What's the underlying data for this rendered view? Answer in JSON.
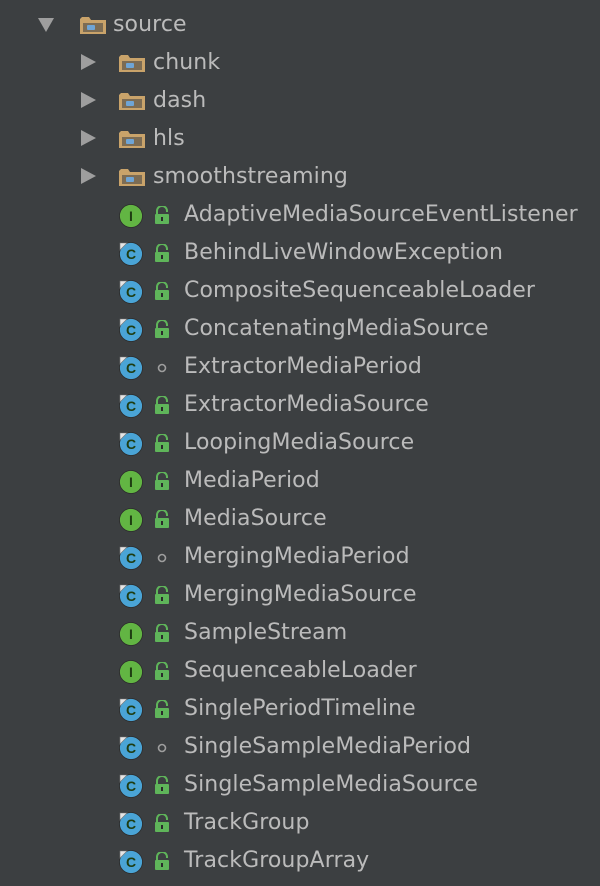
{
  "tree": {
    "colors": {
      "background": "#3c3f41",
      "text": "#bbbbbb",
      "arrow": "#9e9e9e",
      "folder": "#c9a36a",
      "folder_dot": "#6fa5d6",
      "class_icon": "#4aa4d6",
      "interface_icon": "#62b543",
      "lock": "#5fb55a"
    },
    "root": {
      "label": "source",
      "icon": "folder-icon",
      "expanded": true
    },
    "folders": [
      {
        "label": "chunk",
        "icon": "folder-icon",
        "expanded": false
      },
      {
        "label": "dash",
        "icon": "folder-icon",
        "expanded": false
      },
      {
        "label": "hls",
        "icon": "folder-icon",
        "expanded": false
      },
      {
        "label": "smoothstreaming",
        "icon": "folder-icon",
        "expanded": false
      }
    ],
    "files": [
      {
        "label": "AdaptiveMediaSourceEventListener",
        "kind": "interface",
        "kind_letter": "I",
        "visibility": "public"
      },
      {
        "label": "BehindLiveWindowException",
        "kind": "class",
        "kind_letter": "C",
        "visibility": "public"
      },
      {
        "label": "CompositeSequenceableLoader",
        "kind": "class",
        "kind_letter": "C",
        "visibility": "public"
      },
      {
        "label": "ConcatenatingMediaSource",
        "kind": "class",
        "kind_letter": "C",
        "visibility": "public"
      },
      {
        "label": "ExtractorMediaPeriod",
        "kind": "class",
        "kind_letter": "C",
        "visibility": "package"
      },
      {
        "label": "ExtractorMediaSource",
        "kind": "class",
        "kind_letter": "C",
        "visibility": "public"
      },
      {
        "label": "LoopingMediaSource",
        "kind": "class",
        "kind_letter": "C",
        "visibility": "public"
      },
      {
        "label": "MediaPeriod",
        "kind": "interface",
        "kind_letter": "I",
        "visibility": "public"
      },
      {
        "label": "MediaSource",
        "kind": "interface",
        "kind_letter": "I",
        "visibility": "public"
      },
      {
        "label": "MergingMediaPeriod",
        "kind": "class",
        "kind_letter": "C",
        "visibility": "package"
      },
      {
        "label": "MergingMediaSource",
        "kind": "class",
        "kind_letter": "C",
        "visibility": "public"
      },
      {
        "label": "SampleStream",
        "kind": "interface",
        "kind_letter": "I",
        "visibility": "public"
      },
      {
        "label": "SequenceableLoader",
        "kind": "interface",
        "kind_letter": "I",
        "visibility": "public"
      },
      {
        "label": "SinglePeriodTimeline",
        "kind": "class",
        "kind_letter": "C",
        "visibility": "public"
      },
      {
        "label": "SingleSampleMediaPeriod",
        "kind": "class",
        "kind_letter": "C",
        "visibility": "package"
      },
      {
        "label": "SingleSampleMediaSource",
        "kind": "class",
        "kind_letter": "C",
        "visibility": "public"
      },
      {
        "label": "TrackGroup",
        "kind": "class",
        "kind_letter": "C",
        "visibility": "public"
      },
      {
        "label": "TrackGroupArray",
        "kind": "class",
        "kind_letter": "C",
        "visibility": "public"
      }
    ]
  }
}
